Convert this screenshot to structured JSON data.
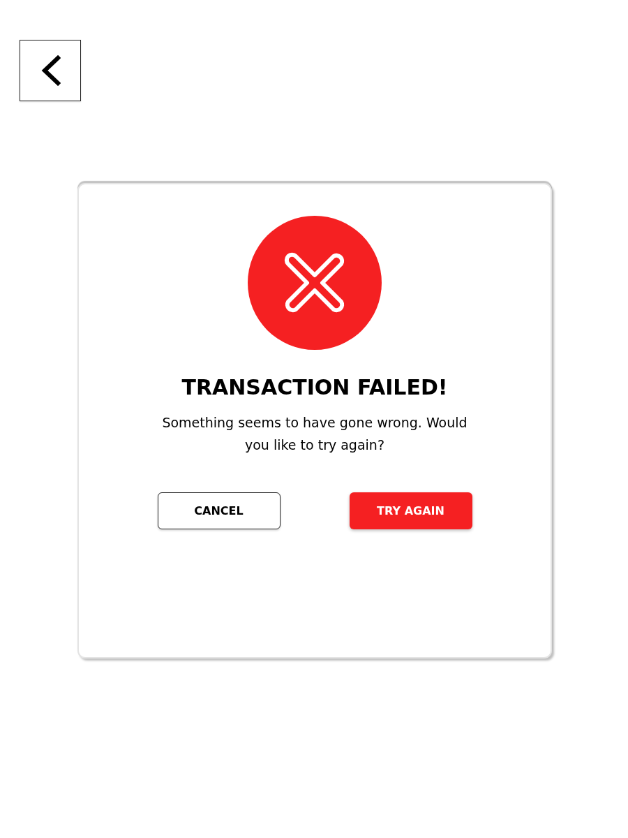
{
  "dialog": {
    "kind": "failure",
    "title": "TRANSACTION FAILED!",
    "message": "Something seems to have gone wrong. Would you like to try again?",
    "buttons": [
      {
        "label": "CANCEL",
        "kind": "secondary"
      },
      {
        "label": "TRY AGAIN",
        "kind": "primary"
      }
    ]
  }
}
